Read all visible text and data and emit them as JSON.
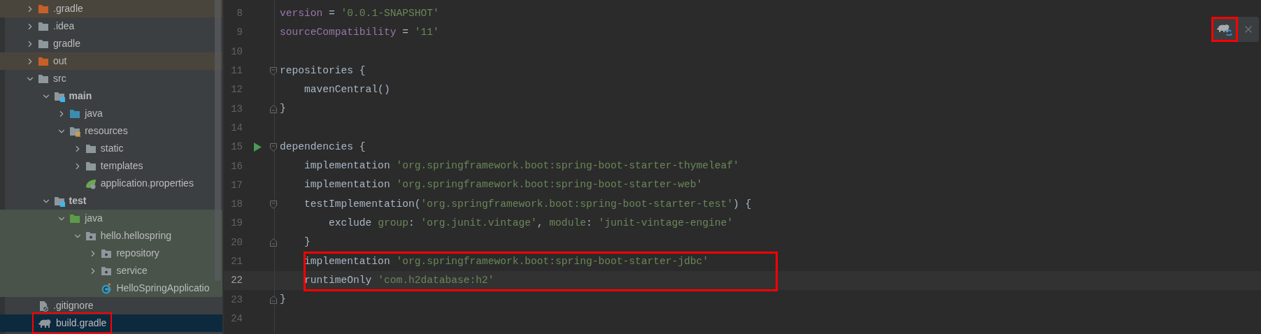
{
  "project_tree": [
    {
      "label": ".gradle",
      "kind": "excluded-folder",
      "expanded": false,
      "bold": false,
      "excluded": true,
      "selected": false,
      "annotated": false
    },
    {
      "label": ".idea",
      "kind": "folder",
      "expanded": false,
      "bold": false,
      "excluded": false,
      "test_source": false,
      "selected": false,
      "annotated": false
    },
    {
      "label": "gradle",
      "kind": "folder",
      "expanded": false,
      "bold": false,
      "excluded": false,
      "test_source": false,
      "selected": false,
      "annotated": false
    },
    {
      "label": "out",
      "kind": "excluded-folder",
      "expanded": false,
      "bold": false,
      "excluded": true,
      "selected": false,
      "annotated": false
    },
    {
      "label": "src",
      "kind": "folder",
      "expanded": true,
      "bold": false,
      "excluded": false,
      "test_source": false,
      "selected": false,
      "annotated": false,
      "children": [
        {
          "label": "main",
          "kind": "module-folder",
          "expanded": true,
          "bold": true,
          "excluded": false,
          "test_source": false,
          "selected": false,
          "annotated": false,
          "children": [
            {
              "label": "java",
              "kind": "source-folder",
              "expanded": false,
              "bold": false,
              "excluded": false,
              "test_source": false,
              "selected": false,
              "annotated": false
            },
            {
              "label": "resources",
              "kind": "resources-folder",
              "expanded": true,
              "bold": false,
              "excluded": false,
              "test_source": false,
              "selected": false,
              "annotated": false,
              "children": [
                {
                  "label": "static",
                  "kind": "folder",
                  "expanded": false,
                  "bold": false,
                  "excluded": false,
                  "test_source": false,
                  "selected": false,
                  "annotated": false
                },
                {
                  "label": "templates",
                  "kind": "folder",
                  "expanded": false,
                  "bold": false,
                  "excluded": false,
                  "test_source": false,
                  "selected": false,
                  "annotated": false
                },
                {
                  "label": "application.properties",
                  "kind": "spring-config",
                  "bold": false,
                  "excluded": false,
                  "test_source": false,
                  "selected": false,
                  "annotated": false
                }
              ]
            }
          ]
        },
        {
          "label": "test",
          "kind": "module-folder",
          "expanded": true,
          "bold": true,
          "excluded": false,
          "test_source": false,
          "selected": false,
          "annotated": false,
          "children": [
            {
              "label": "java",
              "kind": "test-folder",
              "expanded": true,
              "bold": false,
              "excluded": false,
              "test_source": true,
              "selected": false,
              "annotated": false,
              "children": [
                {
                  "label": "hello.hellospring",
                  "kind": "package",
                  "expanded": true,
                  "bold": false,
                  "excluded": false,
                  "test_source": true,
                  "selected": false,
                  "annotated": false,
                  "children": [
                    {
                      "label": "repository",
                      "kind": "package",
                      "expanded": false,
                      "bold": false,
                      "excluded": false,
                      "test_source": true,
                      "selected": false,
                      "annotated": false
                    },
                    {
                      "label": "service",
                      "kind": "package",
                      "expanded": false,
                      "bold": false,
                      "excluded": false,
                      "test_source": true,
                      "selected": false,
                      "annotated": false
                    },
                    {
                      "label": "HelloSpringApplicatio",
                      "kind": "class",
                      "bold": false,
                      "excluded": false,
                      "test_source": true,
                      "selected": false,
                      "annotated": false
                    }
                  ]
                }
              ]
            }
          ]
        }
      ]
    },
    {
      "label": ".gitignore",
      "kind": "ignore-file",
      "bold": false,
      "excluded": false,
      "test_source": false,
      "selected": false,
      "annotated": false
    },
    {
      "label": "build.gradle",
      "kind": "gradle-file",
      "bold": false,
      "selected": true,
      "annotated": true
    }
  ],
  "editor": {
    "lines": [
      {
        "number": "8",
        "current": false,
        "annotated": false,
        "runnable": false,
        "fold_start": false,
        "fold_end": false,
        "tokens": [
          {
            "kind": "property",
            "text": "version"
          },
          {
            "kind": "plain",
            "text": " = "
          },
          {
            "kind": "string",
            "text": "'0.0.1-SNAPSHOT'"
          }
        ]
      },
      {
        "number": "9",
        "current": false,
        "annotated": false,
        "runnable": false,
        "fold_start": false,
        "fold_end": false,
        "tokens": [
          {
            "kind": "property",
            "text": "sourceCompatibility"
          },
          {
            "kind": "plain",
            "text": " = "
          },
          {
            "kind": "string",
            "text": "'11'"
          }
        ]
      },
      {
        "number": "10",
        "current": false,
        "annotated": false,
        "runnable": false,
        "fold_start": false,
        "fold_end": false
      },
      {
        "number": "11",
        "current": false,
        "annotated": false,
        "runnable": false,
        "fold_start": true,
        "fold_end": false,
        "tokens": [
          {
            "kind": "plain",
            "text": "repositories {"
          }
        ]
      },
      {
        "number": "12",
        "current": false,
        "annotated": false,
        "runnable": false,
        "fold_start": false,
        "fold_end": false,
        "tokens": [
          {
            "kind": "plain",
            "text": "    mavenCentral()"
          }
        ]
      },
      {
        "number": "13",
        "current": false,
        "annotated": false,
        "runnable": false,
        "fold_start": false,
        "fold_end": true,
        "tokens": [
          {
            "kind": "plain",
            "text": "}"
          }
        ]
      },
      {
        "number": "14",
        "current": false,
        "annotated": false,
        "runnable": false,
        "fold_start": false,
        "fold_end": false
      },
      {
        "number": "15",
        "current": false,
        "annotated": false,
        "runnable": true,
        "fold_start": true,
        "fold_end": false,
        "tokens": [
          {
            "kind": "plain",
            "text": "dependencies {"
          }
        ]
      },
      {
        "number": "16",
        "current": false,
        "annotated": false,
        "runnable": false,
        "fold_start": false,
        "fold_end": false,
        "tokens": [
          {
            "kind": "plain",
            "text": "    implementation "
          },
          {
            "kind": "string",
            "text": "'org.springframework.boot:spring-boot-starter-thymeleaf'"
          }
        ]
      },
      {
        "number": "17",
        "current": false,
        "annotated": false,
        "runnable": false,
        "fold_start": false,
        "fold_end": false,
        "tokens": [
          {
            "kind": "plain",
            "text": "    implementation "
          },
          {
            "kind": "string",
            "text": "'org.springframework.boot:spring-boot-starter-web'"
          }
        ]
      },
      {
        "number": "18",
        "current": false,
        "annotated": false,
        "runnable": false,
        "fold_start": true,
        "fold_end": false,
        "tokens": [
          {
            "kind": "plain",
            "text": "    testImplementation("
          },
          {
            "kind": "string",
            "text": "'org.springframework.boot:spring-boot-starter-test'"
          },
          {
            "kind": "plain",
            "text": ") {"
          }
        ]
      },
      {
        "number": "19",
        "current": false,
        "annotated": false,
        "runnable": false,
        "fold_start": false,
        "fold_end": false,
        "tokens": [
          {
            "kind": "plain",
            "text": "        exclude "
          },
          {
            "kind": "named",
            "text": "group"
          },
          {
            "kind": "plain",
            "text": ": "
          },
          {
            "kind": "string",
            "text": "'org.junit.vintage'"
          },
          {
            "kind": "plain",
            "text": ", "
          },
          {
            "kind": "named",
            "text": "module"
          },
          {
            "kind": "plain",
            "text": ": "
          },
          {
            "kind": "string",
            "text": "'junit-vintage-engine'"
          }
        ]
      },
      {
        "number": "20",
        "current": false,
        "annotated": false,
        "runnable": false,
        "fold_start": false,
        "fold_end": true,
        "tokens": [
          {
            "kind": "plain",
            "text": "    }"
          }
        ]
      },
      {
        "number": "21",
        "current": false,
        "annotated": true,
        "runnable": false,
        "fold_start": false,
        "fold_end": false,
        "tokens": [
          {
            "kind": "plain",
            "text": "    implementation "
          },
          {
            "kind": "string",
            "text": "'org.springframework.boot:spring-boot-starter-jdbc'"
          }
        ]
      },
      {
        "number": "22",
        "current": true,
        "annotated": true,
        "runnable": false,
        "fold_start": false,
        "fold_end": false,
        "tokens": [
          {
            "kind": "plain",
            "text": "    runtimeOnly "
          },
          {
            "kind": "string",
            "text": "'com.h2database:h2'"
          }
        ]
      },
      {
        "number": "23",
        "current": false,
        "annotated": false,
        "runnable": false,
        "fold_start": false,
        "fold_end": true,
        "tokens": [
          {
            "kind": "plain",
            "text": "}"
          }
        ]
      },
      {
        "number": "24",
        "current": false,
        "annotated": false,
        "runnable": false,
        "fold_start": false,
        "fold_end": false
      }
    ]
  },
  "notification": {
    "sync_button": {
      "annotated": true
    }
  }
}
